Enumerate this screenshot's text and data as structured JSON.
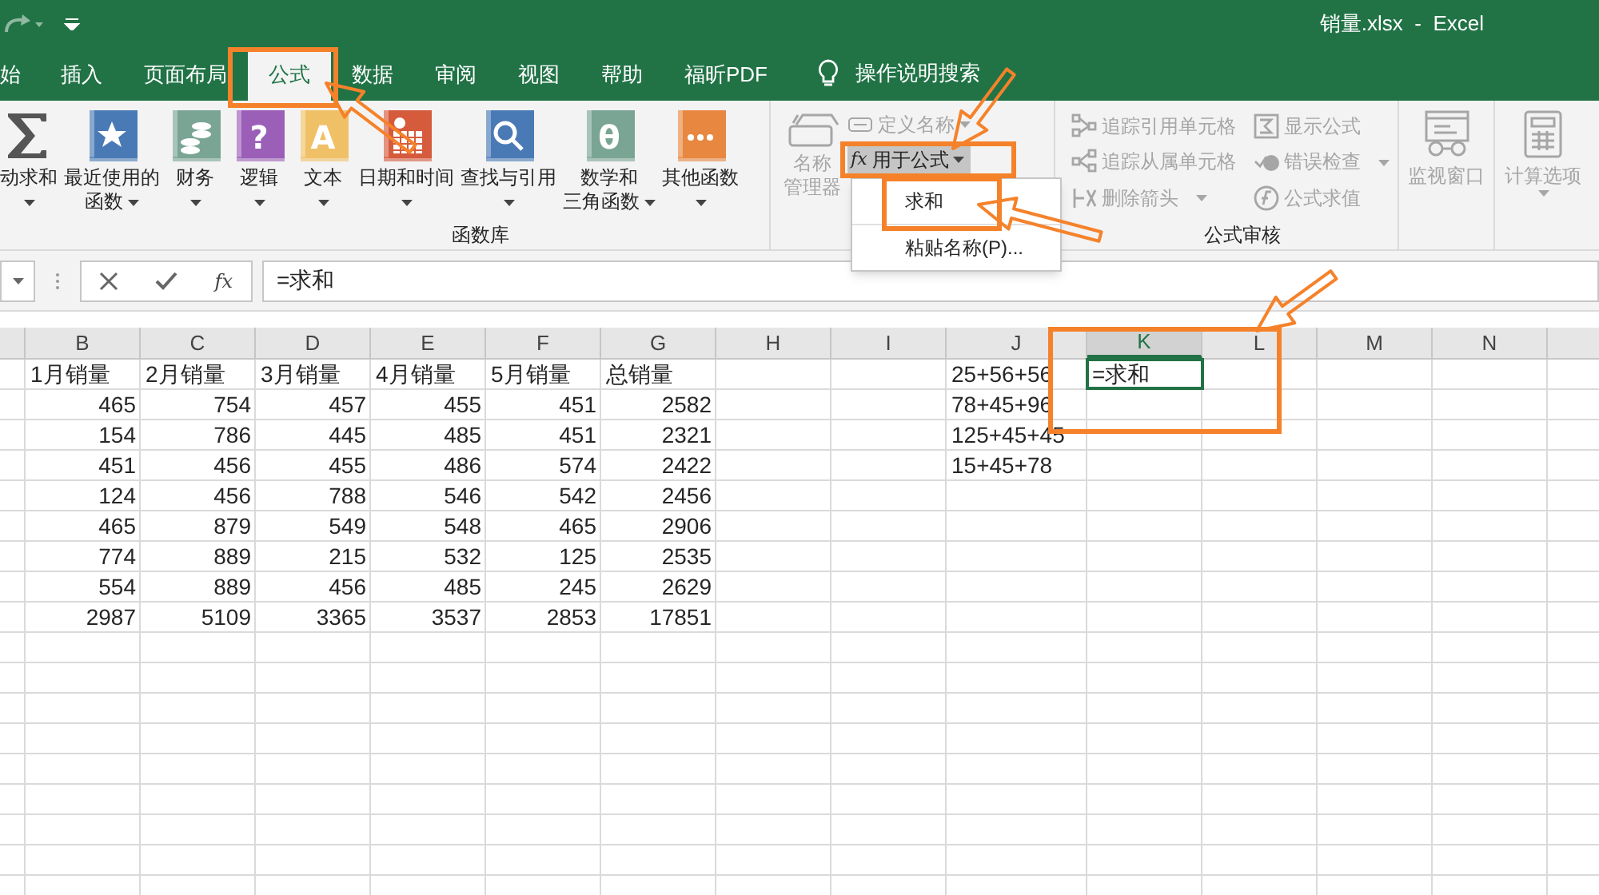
{
  "title_bar": {
    "title": "销量.xlsx  -  Excel"
  },
  "tabs": [
    {
      "label": "始",
      "selected": false
    },
    {
      "label": "插入",
      "selected": false
    },
    {
      "label": "页面布局",
      "selected": false
    },
    {
      "label": "公式",
      "selected": true
    },
    {
      "label": "数据",
      "selected": false
    },
    {
      "label": "审阅",
      "selected": false
    },
    {
      "label": "视图",
      "selected": false
    },
    {
      "label": "帮助",
      "selected": false
    },
    {
      "label": "福昕PDF",
      "selected": false
    }
  ],
  "tell_me": "操作说明搜索",
  "function_library": {
    "label": "函数库",
    "buttons": [
      {
        "kind": "sigma",
        "lines": [
          "动求和"
        ]
      },
      {
        "kind": "star",
        "color": "#4a7ab5",
        "lines": [
          "最近使用的",
          "函数"
        ]
      },
      {
        "kind": "coins",
        "color": "#7aa595",
        "lines": [
          "财务"
        ]
      },
      {
        "kind": "glyph",
        "glyph": "?",
        "color": "#9b5fb8",
        "lines": [
          "逻辑"
        ]
      },
      {
        "kind": "glyph",
        "glyph": "A",
        "color": "#f0c066",
        "lines": [
          "文本"
        ]
      },
      {
        "kind": "calendar",
        "color": "#d65a3c",
        "lines": [
          "日期和时间"
        ]
      },
      {
        "kind": "magnifier",
        "color": "#4a7ab5",
        "lines": [
          "查找与引用"
        ]
      },
      {
        "kind": "glyph",
        "glyph": "θ",
        "color": "#7aa595",
        "lines": [
          "数学和",
          "三角函数"
        ]
      },
      {
        "kind": "dots",
        "color": "#e8873f",
        "lines": [
          "其他函数"
        ]
      }
    ]
  },
  "defined_names": {
    "manager": {
      "lines": [
        "名称",
        "管理器"
      ],
      "disabled": true
    },
    "define": {
      "label": "定义名称",
      "disabled": true
    },
    "use_in_formula": {
      "icon_text": "fx",
      "label": "用于公式",
      "pressed": true
    },
    "menu": [
      "求和",
      "粘贴名称(P)..."
    ]
  },
  "formula_auditing": {
    "label": "公式审核",
    "items": [
      {
        "kind": "trace-precedents",
        "label": "追踪引用单元格",
        "disabled": true,
        "dropdown": false
      },
      {
        "kind": "trace-dependents",
        "label": "追踪从属单元格",
        "disabled": true,
        "dropdown": false
      },
      {
        "kind": "remove-arrows",
        "label": "删除箭头",
        "disabled": true,
        "dropdown": true
      },
      {
        "kind": "show-formulas",
        "label": "显示公式",
        "disabled": true,
        "dropdown": false
      },
      {
        "kind": "error-check",
        "label": "错误检查",
        "disabled": true,
        "dropdown": true
      },
      {
        "kind": "evaluate",
        "label": "公式求值",
        "disabled": true,
        "dropdown": false
      }
    ]
  },
  "watch_window": {
    "label": "监视窗口",
    "disabled": true
  },
  "calc_options": {
    "label": "计算选项",
    "disabled": true
  },
  "formula_bar": {
    "fx": "fx",
    "formula": "=求和"
  },
  "columns": [
    {
      "letter": "B",
      "selected": false
    },
    {
      "letter": "C",
      "selected": false
    },
    {
      "letter": "D",
      "selected": false
    },
    {
      "letter": "E",
      "selected": false
    },
    {
      "letter": "F",
      "selected": false
    },
    {
      "letter": "G",
      "selected": false
    },
    {
      "letter": "H",
      "selected": false
    },
    {
      "letter": "I",
      "selected": false
    },
    {
      "letter": "J",
      "selected": false
    },
    {
      "letter": "K",
      "selected": true
    },
    {
      "letter": "L",
      "selected": false
    },
    {
      "letter": "M",
      "selected": false
    },
    {
      "letter": "N",
      "selected": false
    }
  ],
  "rows": [
    {
      "kind": "header",
      "values": [
        "1月销量",
        "2月销量",
        "3月销量",
        "4月销量",
        "5月销量",
        "总销量"
      ],
      "formula_text": "25+56+56",
      "active_cell": "=求和"
    },
    {
      "kind": "data",
      "values": [
        "465",
        "754",
        "457",
        "455",
        "451",
        "2582"
      ],
      "formula_text": "78+45+96"
    },
    {
      "kind": "data",
      "values": [
        "154",
        "786",
        "445",
        "485",
        "451",
        "2321"
      ],
      "formula_text": "125+45+45"
    },
    {
      "kind": "data",
      "values": [
        "451",
        "456",
        "455",
        "486",
        "574",
        "2422"
      ],
      "formula_text": "15+45+78"
    },
    {
      "kind": "data",
      "values": [
        "124",
        "456",
        "788",
        "546",
        "542",
        "2456"
      ]
    },
    {
      "kind": "data",
      "values": [
        "465",
        "879",
        "549",
        "548",
        "465",
        "2906"
      ]
    },
    {
      "kind": "data",
      "values": [
        "774",
        "889",
        "215",
        "532",
        "125",
        "2535"
      ]
    },
    {
      "kind": "data",
      "values": [
        "554",
        "889",
        "456",
        "485",
        "245",
        "2629"
      ]
    },
    {
      "kind": "data",
      "values": [
        "2987",
        "5109",
        "3365",
        "3537",
        "2853",
        "17851"
      ]
    }
  ]
}
